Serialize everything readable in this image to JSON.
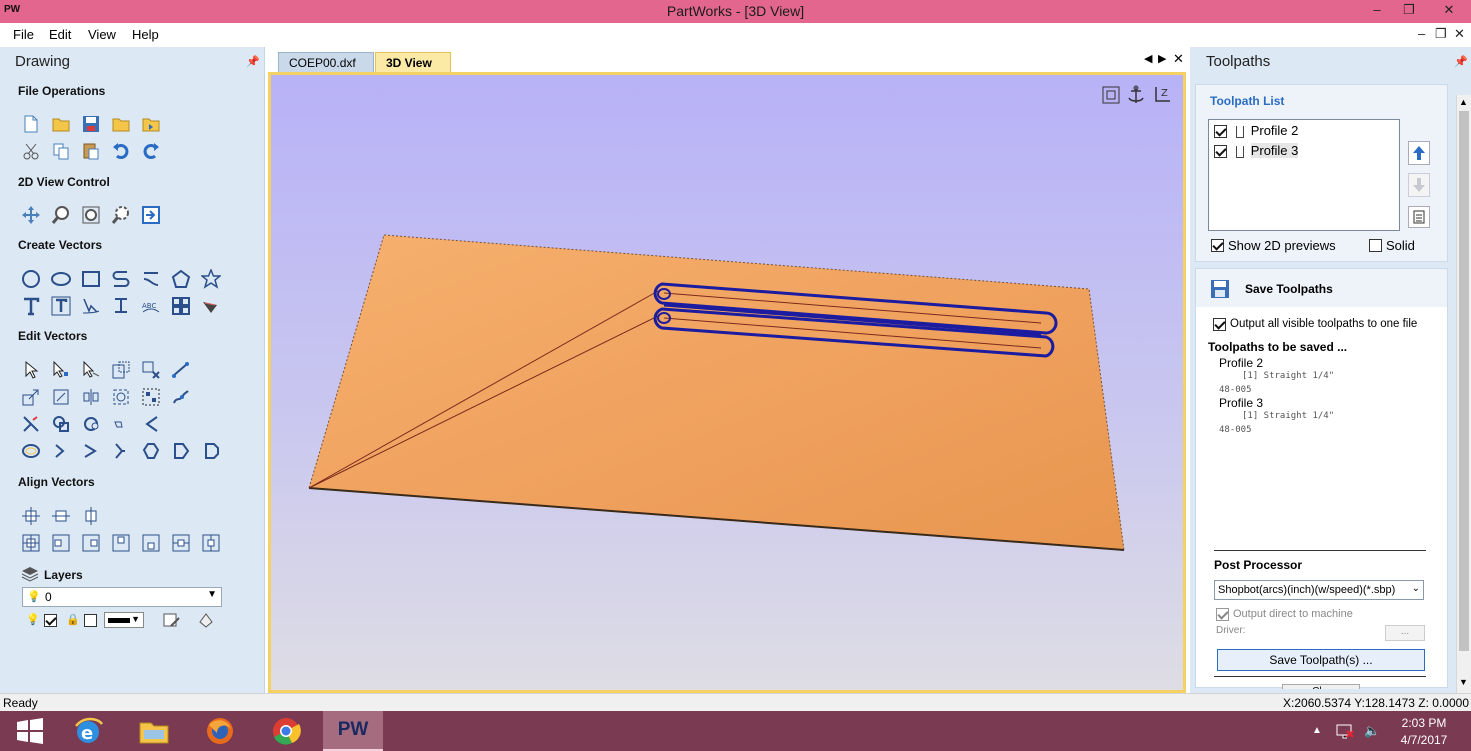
{
  "titlebar": {
    "app_icon": "PW",
    "title": "PartWorks - [3D View]",
    "minimize": "‒",
    "restore": "❐",
    "close": "✕"
  },
  "menubar": {
    "items": [
      "File",
      "Edit",
      "View",
      "Help"
    ],
    "mdi_minimize": "‒",
    "mdi_restore": "❐",
    "mdi_close": "✕"
  },
  "drawing_panel": {
    "title": "Drawing",
    "sections": {
      "file_operations": "File Operations",
      "view_control": "2D View Control",
      "create_vectors": "Create Vectors",
      "edit_vectors": "Edit Vectors",
      "align_vectors": "Align Vectors",
      "layers": "Layers"
    },
    "layer_value": "0"
  },
  "tabs": [
    {
      "label": "COEP00.dxf",
      "active": false
    },
    {
      "label": "3D View",
      "active": true
    }
  ],
  "toolpaths_panel": {
    "title": "Toolpaths",
    "list_title": "Toolpath List",
    "items": [
      {
        "label": "Profile 2",
        "checked": true
      },
      {
        "label": "Profile 3",
        "checked": true
      }
    ],
    "show_2d_previews": "Show 2D previews",
    "solid": "Solid",
    "save_title": "Save Toolpaths",
    "output_all": "Output all visible toolpaths to one file",
    "to_be_saved_title": "Toolpaths to be saved ...",
    "saved": [
      {
        "name": "Profile 2",
        "tool": "[1] Straight 1/4\"",
        "code": "48-005"
      },
      {
        "name": "Profile 3",
        "tool": "[1] Straight 1/4\"",
        "code": "48-005"
      }
    ],
    "post_processor_title": "Post Processor",
    "post_processor_value": "Shopbot(arcs)(inch)(w/speed)(*.sbp)",
    "output_direct": "Output direct to machine",
    "driver_label": "Driver:",
    "driver_button": "...",
    "save_button": "Save Toolpath(s) ...",
    "close_partial": "Cl..."
  },
  "statusbar": {
    "status": "Ready",
    "coords": "X:2060.5374 Y:128.1473 Z: 0.0000"
  },
  "taskbar": {
    "time": "2:03 PM",
    "date": "4/7/2017",
    "pw_label": "PW"
  },
  "colors": {
    "titlebar": "#e3668f",
    "panel_bg": "#dce8f3",
    "viewport_top": "#b8b2f7",
    "board": "#f0a464",
    "toolpath": "#1c1ca0",
    "accent": "#2a6cc4",
    "taskbar": "#7a3a52"
  }
}
